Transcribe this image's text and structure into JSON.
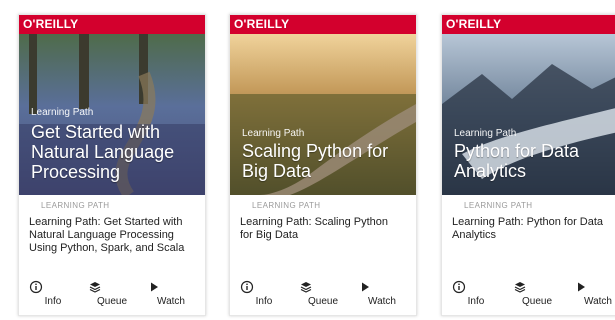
{
  "cards": [
    {
      "brand": "O'REILLY",
      "cover_kicker": "Learning Path",
      "cover_title": "Get Started with Natural Language Processing",
      "tag": "LEARNING PATH",
      "title": "Learning Path: Get Started with Natural Language Processing Using Python, Spark, and Scala",
      "actions": {
        "info": "Info",
        "queue": "Queue",
        "watch": "Watch"
      }
    },
    {
      "brand": "O'REILLY",
      "cover_kicker": "Learning Path",
      "cover_title": "Scaling Python for Big Data",
      "tag": "LEARNING PATH",
      "title": "Learning Path: Scaling Python for Big Data",
      "actions": {
        "info": "Info",
        "queue": "Queue",
        "watch": "Watch"
      }
    },
    {
      "brand": "O'REILLY",
      "cover_kicker": "Learning Path",
      "cover_title": "Python for Data Analytics",
      "tag": "LEARNING PATH",
      "title": "Learning Path: Python for Data Analytics",
      "actions": {
        "info": "Info",
        "queue": "Queue",
        "watch": "Watch"
      }
    }
  ],
  "colors": {
    "brand_red": "#d3002d"
  },
  "icons": {
    "info": "info-icon",
    "queue": "queue-icon",
    "watch": "play-icon"
  }
}
